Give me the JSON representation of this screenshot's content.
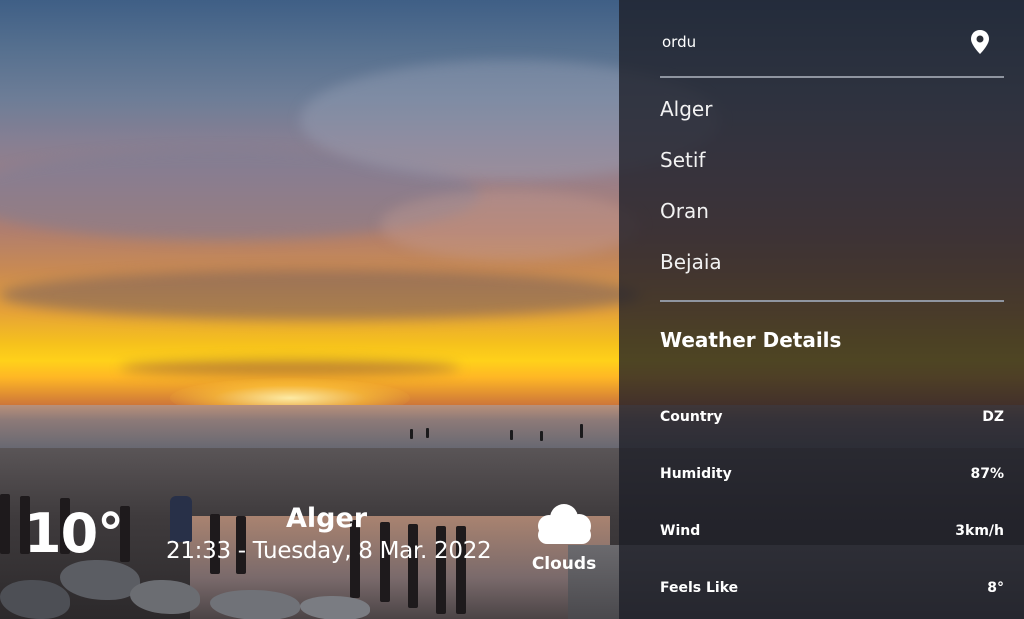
{
  "current": {
    "temperature": "10°",
    "city": "Alger",
    "datetime": "21:33 - Tuesday, 8 Mar. 2022",
    "condition": "Clouds",
    "condition_icon": "cloud-icon"
  },
  "search": {
    "value": "ordu",
    "location_icon": "map-pin-icon"
  },
  "cities": [
    {
      "label": "Alger"
    },
    {
      "label": "Setif"
    },
    {
      "label": "Oran"
    },
    {
      "label": "Bejaia"
    }
  ],
  "details": {
    "title": "Weather Details",
    "rows": [
      {
        "label": "Country",
        "value": "DZ"
      },
      {
        "label": "Humidity",
        "value": "87%"
      },
      {
        "label": "Wind",
        "value": "3km/h"
      },
      {
        "label": "Feels Like",
        "value": "8°"
      }
    ]
  },
  "colors": {
    "panel_background": "#1c1e26",
    "divider": "#8f95a0",
    "text": "#ffffff"
  }
}
